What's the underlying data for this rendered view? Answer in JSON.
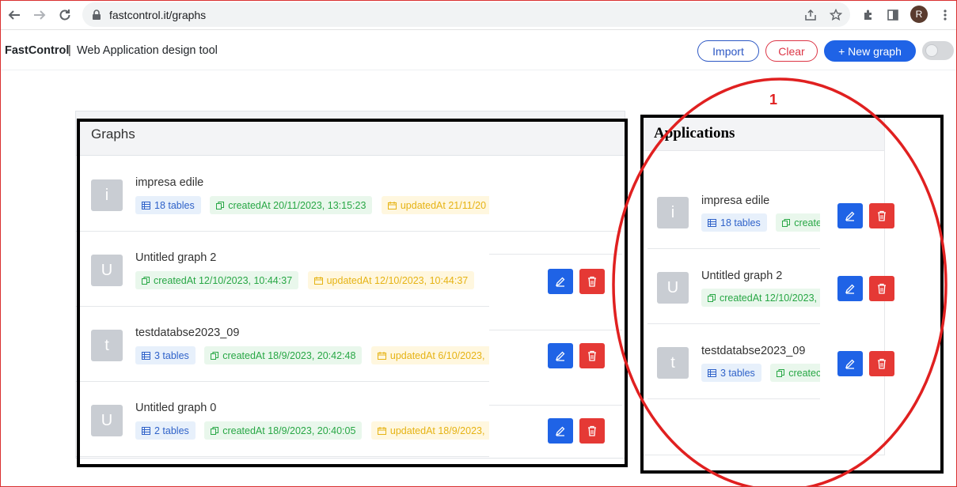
{
  "browser": {
    "url": "fastcontrol.it/graphs",
    "profile_initial": "R",
    "icons": [
      "back-arrow-icon",
      "forward-arrow-icon",
      "reload-icon",
      "lock-icon",
      "share-icon",
      "star-icon",
      "puzzle-icon",
      "sidebar-icon",
      "kebab-menu-icon"
    ]
  },
  "header": {
    "brand": "FastControl",
    "separator": "|",
    "tagline": "Web Application design tool",
    "import_label": "Import",
    "clear_label": "Clear",
    "new_graph_label": "+ New graph",
    "theme_toggle": "off"
  },
  "graphs": {
    "title": "Graphs",
    "rows": [
      {
        "initial": "i",
        "name": "impresa edile",
        "tables": "18 tables",
        "created": "createdAt 20/11/2023, 13:15:23",
        "updated": "updatedAt 21/11/20"
      },
      {
        "initial": "U",
        "name": "Untitled graph 2",
        "tables": "",
        "created": "createdAt 12/10/2023, 10:44:37",
        "updated": "updatedAt 12/10/2023, 10:44:37"
      },
      {
        "initial": "t",
        "name": "testdatabse2023_09",
        "tables": "3 tables",
        "created": "createdAt 18/9/2023, 20:42:48",
        "updated": "updatedAt 6/10/2023,"
      },
      {
        "initial": "U",
        "name": "Untitled graph 0",
        "tables": "2 tables",
        "created": "createdAt 18/9/2023, 20:40:05",
        "updated": "updatedAt 18/9/2023,"
      }
    ]
  },
  "applications": {
    "title": "Applications",
    "rows": [
      {
        "initial": "i",
        "name": "impresa edile",
        "tables": "18 tables",
        "created": "create"
      },
      {
        "initial": "U",
        "name": "Untitled graph 2",
        "tables": "",
        "created": "createdAt 12/10/2023,"
      },
      {
        "initial": "t",
        "name": "testdatabse2023_09",
        "tables": "3 tables",
        "created": "createc"
      }
    ]
  },
  "annotation": {
    "number": "1",
    "box_color": "#000000",
    "ellipse_color": "#e02020"
  },
  "colors": {
    "primary": "#1f63e6",
    "danger": "#e53935",
    "tag_blue": "#2f62c9",
    "tag_green": "#28a745",
    "tag_yellow": "#e6b314"
  }
}
